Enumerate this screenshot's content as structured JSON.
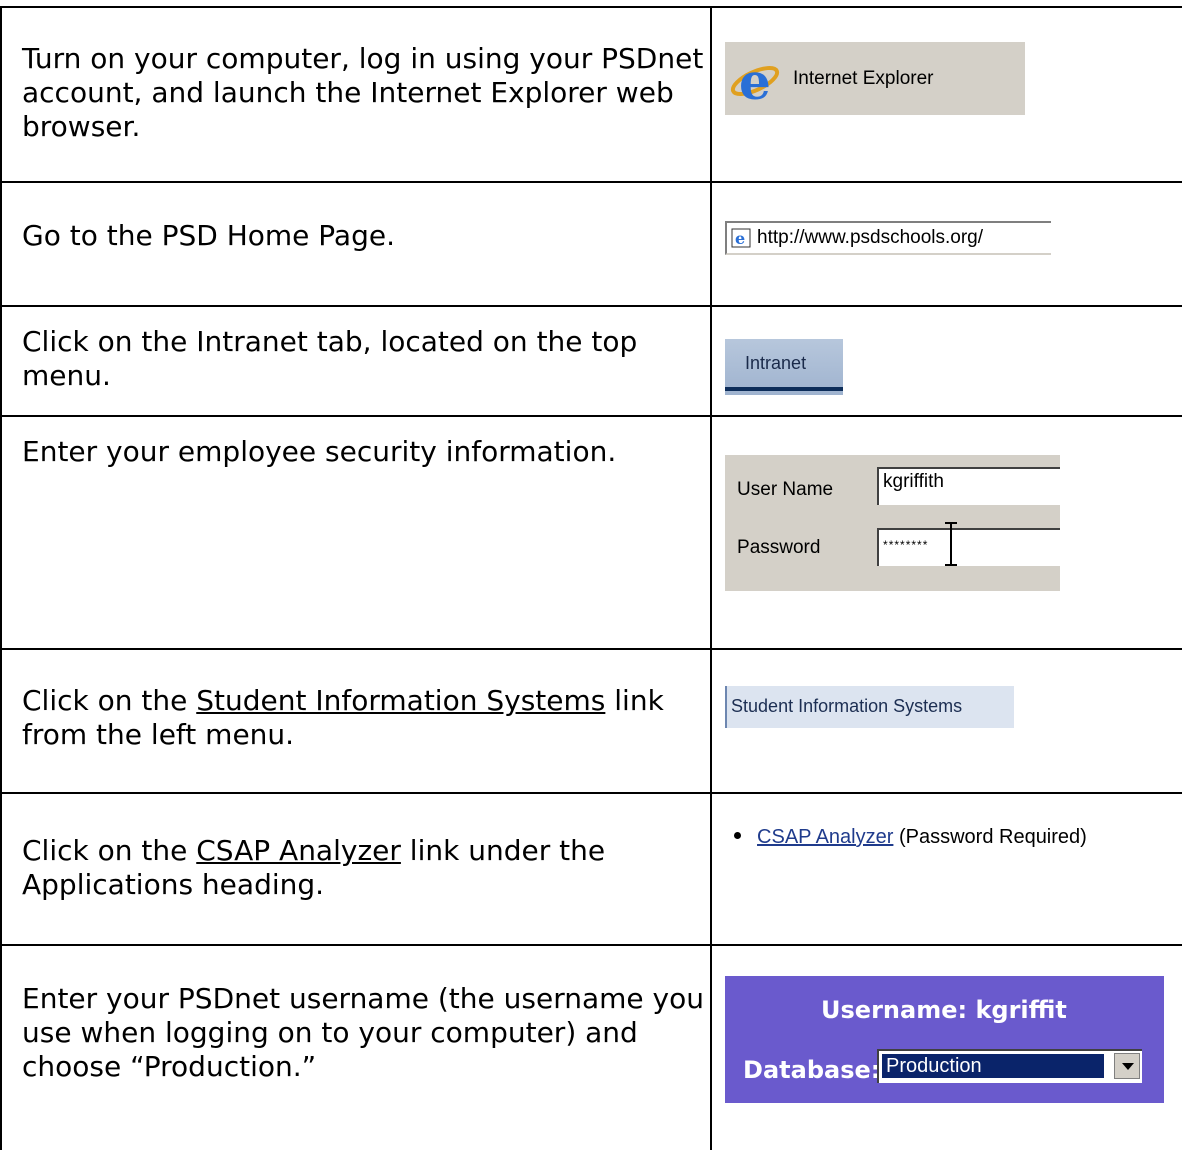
{
  "steps": [
    {
      "text": "Turn on your computer, log in using your PSDnet account, and launch the Internet Explorer web browser.",
      "shot": {
        "label": "Internet Explorer",
        "icon": "internet-explorer-icon"
      }
    },
    {
      "text": "Go to the PSD Home Page.",
      "shot": {
        "url": "http://www.psdschools.org/",
        "icon": "ie-page-icon"
      }
    },
    {
      "text": "Click on the Intranet tab, located on the top menu.",
      "shot": {
        "tab": "Intranet"
      }
    },
    {
      "text": "Enter your employee security information.",
      "shot": {
        "user_label": "User Name",
        "user_value": "kgriffith",
        "pass_label": "Password",
        "pass_value": "********"
      }
    },
    {
      "text_before": "Click on the ",
      "link": "Student Information Systems",
      "text_after": " link from the left menu.",
      "shot": {
        "label": "Student Information Systems"
      }
    },
    {
      "text_before": "Click on the ",
      "link": "CSAP Analyzer",
      "text_after": " link under the Applications heading.",
      "shot": {
        "link": "CSAP Analyzer",
        "note": "(Password Required)"
      }
    },
    {
      "text": "Enter your PSDnet username (the username you use when logging on to your computer) and choose “Production.”",
      "shot": {
        "username": "Username: kgriffit",
        "db_label": "Database:",
        "db_value": "Production"
      }
    }
  ],
  "colors": {
    "accent_purple": "#6a5acd",
    "ie_gray": "#d4d0c8",
    "link_blue": "#1f3b8c"
  }
}
